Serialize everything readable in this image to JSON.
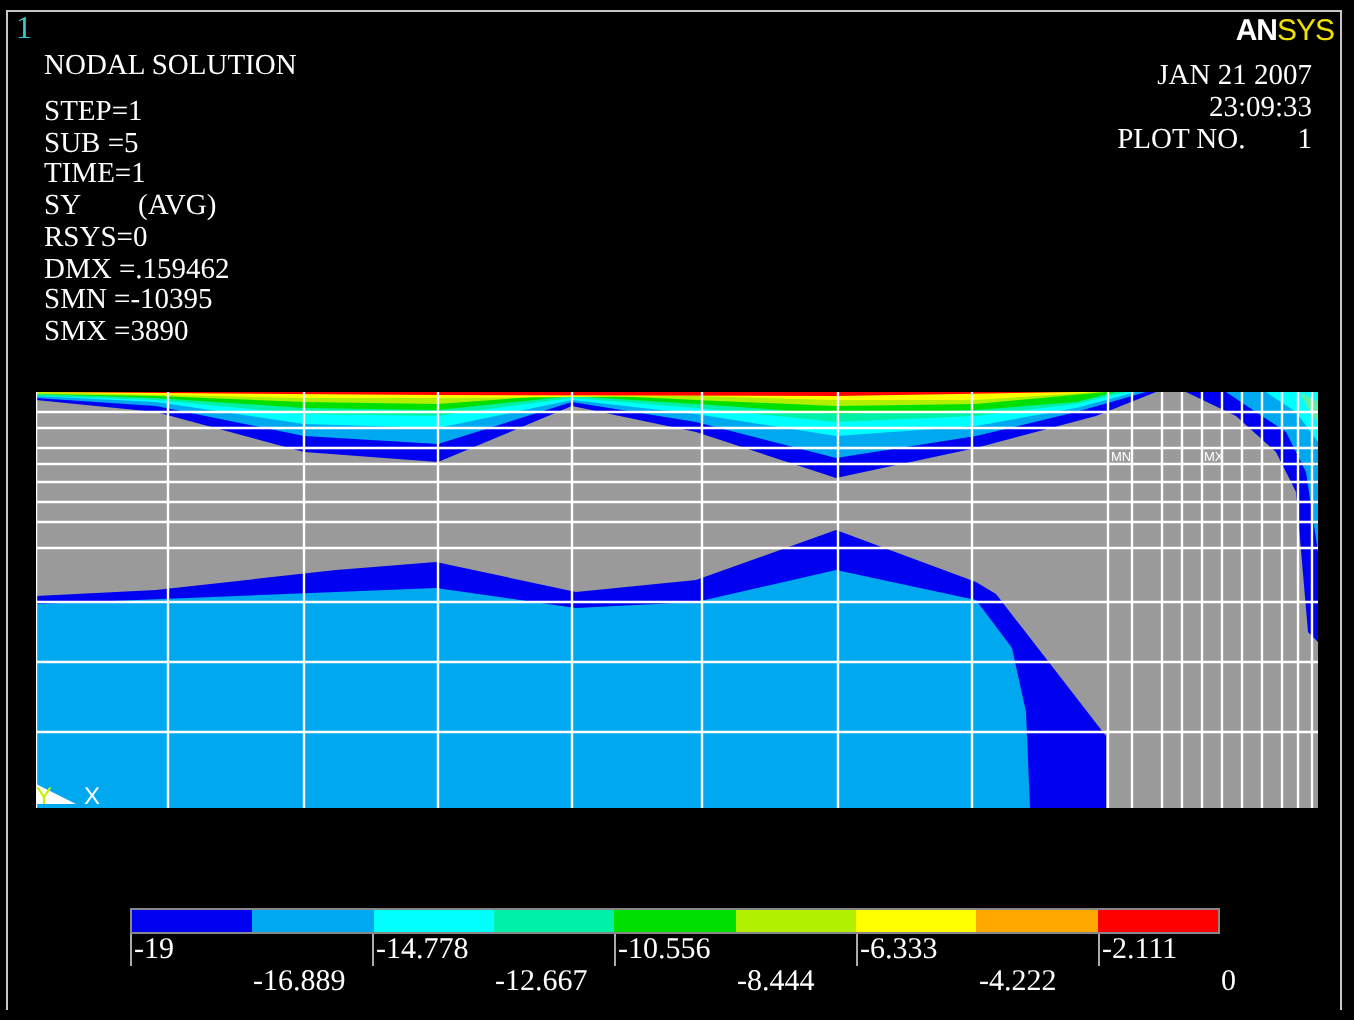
{
  "window_number": "1",
  "logo": {
    "part_1": "AN",
    "part_2": "SYS"
  },
  "title": "NODAL SOLUTION",
  "info_lines": [
    "STEP=1",
    "SUB =5",
    "TIME=1",
    "SY        (AVG)",
    "RSYS=0",
    "DMX =.159462",
    "SMN =-10395",
    "SMX =3890"
  ],
  "date": "JAN 21 2007",
  "time": "23:09:33",
  "plot_no": {
    "label": "PLOT NO.",
    "value": "1"
  },
  "plot": {
    "min_marker": "MN",
    "max_marker": "MX",
    "axis_labels": [
      "Y",
      "X"
    ]
  },
  "legend": {
    "bands": [
      {
        "color": "#0000f0"
      },
      {
        "color": "#00a8f0"
      },
      {
        "color": "#00ffff"
      },
      {
        "color": "#00f0a8"
      },
      {
        "color": "#00e000"
      },
      {
        "color": "#b0f000"
      },
      {
        "color": "#ffff00"
      },
      {
        "color": "#ffa800"
      },
      {
        "color": "#ff0000"
      }
    ],
    "labels": [
      "-19",
      "-16.889",
      "-14.778",
      "-12.667",
      "-10.556",
      "-8.444",
      "-6.333",
      "-4.222",
      "-2.111",
      "0"
    ]
  }
}
